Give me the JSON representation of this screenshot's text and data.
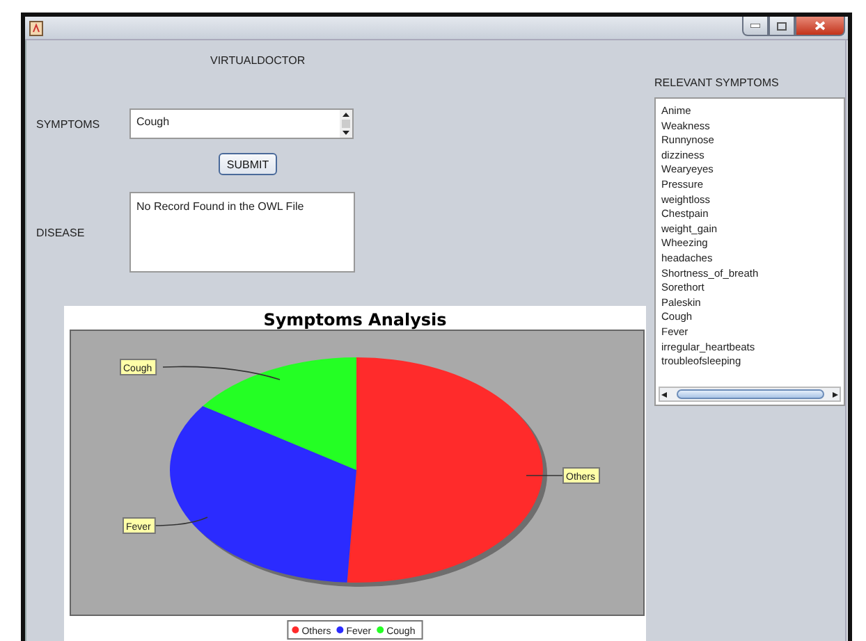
{
  "heading": "VIRTUALDOCTOR",
  "symptoms": {
    "label": "SYMPTOMS",
    "value": "Cough"
  },
  "submit_button": "SUBMIT",
  "disease": {
    "label": "DISEASE",
    "value": "No Record Found in the OWL File"
  },
  "chart": {
    "title": "Symptoms Analysis",
    "slices": [
      {
        "label": "Others",
        "color": "#ff2b2b"
      },
      {
        "label": "Fever",
        "color": "#2b2bff"
      },
      {
        "label": "Cough",
        "color": "#24ff24"
      }
    ],
    "legend": [
      {
        "label": "Others",
        "color": "#ff2b2b"
      },
      {
        "label": "Fever",
        "color": "#2b2bff"
      },
      {
        "label": "Cough",
        "color": "#24ff24"
      }
    ]
  },
  "relevant_symptoms": {
    "title": "RELEVANT SYMPTOMS",
    "items": [
      "Anime",
      "Weakness",
      "Runnynose",
      "dizziness",
      "Wearyeyes",
      "Pressure",
      "weightloss",
      "Chestpain",
      "weight_gain",
      "Wheezing",
      "headaches",
      "Shortness_of_breath",
      "Sorethort",
      "Paleskin",
      "Cough",
      "Fever",
      "irregular_heartbeats",
      "troubleofsleeping"
    ]
  }
}
